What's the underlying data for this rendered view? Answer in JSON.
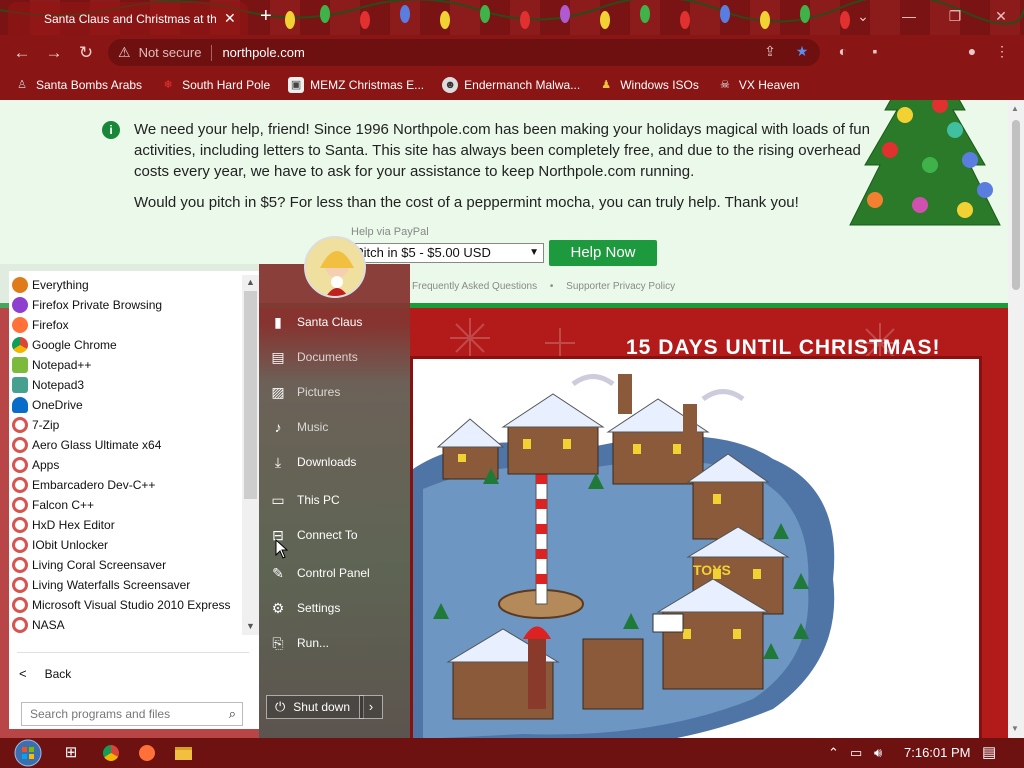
{
  "browser": {
    "tab_title": "Santa Claus and Christmas at the North Pole",
    "address_security": "Not secure",
    "address_url": "northpole.com"
  },
  "bookmarks": [
    {
      "label": "Santa Bombs Arabs",
      "icon": "person-icon"
    },
    {
      "label": "South Hard Pole",
      "icon": "snowflake-icon"
    },
    {
      "label": "MEMZ Christmas E...",
      "icon": "image-icon"
    },
    {
      "label": "Endermanch Malwa...",
      "icon": "creature-icon"
    },
    {
      "label": "Windows ISOs",
      "icon": "user-icon"
    },
    {
      "label": "VX Heaven",
      "icon": "skull-icon"
    }
  ],
  "notice": {
    "paragraph1": "We need your help, friend! Since 1996 Northpole.com has been making your holidays magical with loads of fun activities, including letters to Santa. This site has always been completely free, and due to the rising overhead costs every year, we have to ask for your assistance to keep Northpole.com running.",
    "paragraph2": "Would you pitch in $5? For less than the cost of a peppermint mocha, you can truly help. Thank you!"
  },
  "donation": {
    "paypal_label": "Help via PayPal",
    "pitch_option": "Pitch in $5 - $5.00 USD",
    "help_button": "Help Now",
    "faq_link": "Frequently Asked Questions",
    "privacy_link": "Supporter Privacy Policy"
  },
  "christmas": {
    "countdown": "15 DAYS UNTIL CHRISTMAS!",
    "toys_sign": "TOYS"
  },
  "start_menu": {
    "programs": [
      {
        "label": "Everything",
        "color": "#e07b1c"
      },
      {
        "label": "Firefox Private Browsing",
        "color": "#8e3fd0"
      },
      {
        "label": "Firefox",
        "color": "#ff7139"
      },
      {
        "label": "Google Chrome",
        "color": "#4285f4"
      },
      {
        "label": "Notepad++",
        "color": "#7cba3e"
      },
      {
        "label": "Notepad3",
        "color": "#46a08f"
      },
      {
        "label": "OneDrive",
        "color": "#0a6cc9"
      },
      {
        "label": "7-Zip",
        "color": "#d9534f"
      },
      {
        "label": "Aero Glass Ultimate x64",
        "color": "#d9534f"
      },
      {
        "label": "Apps",
        "color": "#d9534f"
      },
      {
        "label": "Embarcadero Dev-C++",
        "color": "#d9534f"
      },
      {
        "label": "Falcon C++",
        "color": "#d9534f"
      },
      {
        "label": "HxD Hex Editor",
        "color": "#d9534f"
      },
      {
        "label": "IObit Unlocker",
        "color": "#d9534f"
      },
      {
        "label": "Living Coral Screensaver",
        "color": "#d9534f"
      },
      {
        "label": "Living Waterfalls Screensaver",
        "color": "#d9534f"
      },
      {
        "label": "Microsoft Visual Studio 2010 Express",
        "color": "#d9534f"
      },
      {
        "label": "NASA",
        "color": "#d9534f"
      }
    ],
    "back_label": "Back",
    "search_placeholder": "Search programs and files",
    "right_items": [
      {
        "label": "Santa Claus",
        "icon": "user-icon"
      },
      {
        "label": "Documents",
        "icon": "document-icon"
      },
      {
        "label": "Pictures",
        "icon": "picture-icon"
      },
      {
        "label": "Music",
        "icon": "music-icon"
      },
      {
        "label": "Downloads",
        "icon": "download-icon"
      },
      {
        "label": "This PC",
        "icon": "computer-icon"
      },
      {
        "label": "Connect To",
        "icon": "network-icon"
      },
      {
        "label": "Control Panel",
        "icon": "wrench-icon"
      },
      {
        "label": "Settings",
        "icon": "gear-icon"
      },
      {
        "label": "Run...",
        "icon": "run-icon"
      }
    ],
    "shutdown_label": "Shut down"
  },
  "taskbar": {
    "clock": "7:16:01 PM"
  }
}
